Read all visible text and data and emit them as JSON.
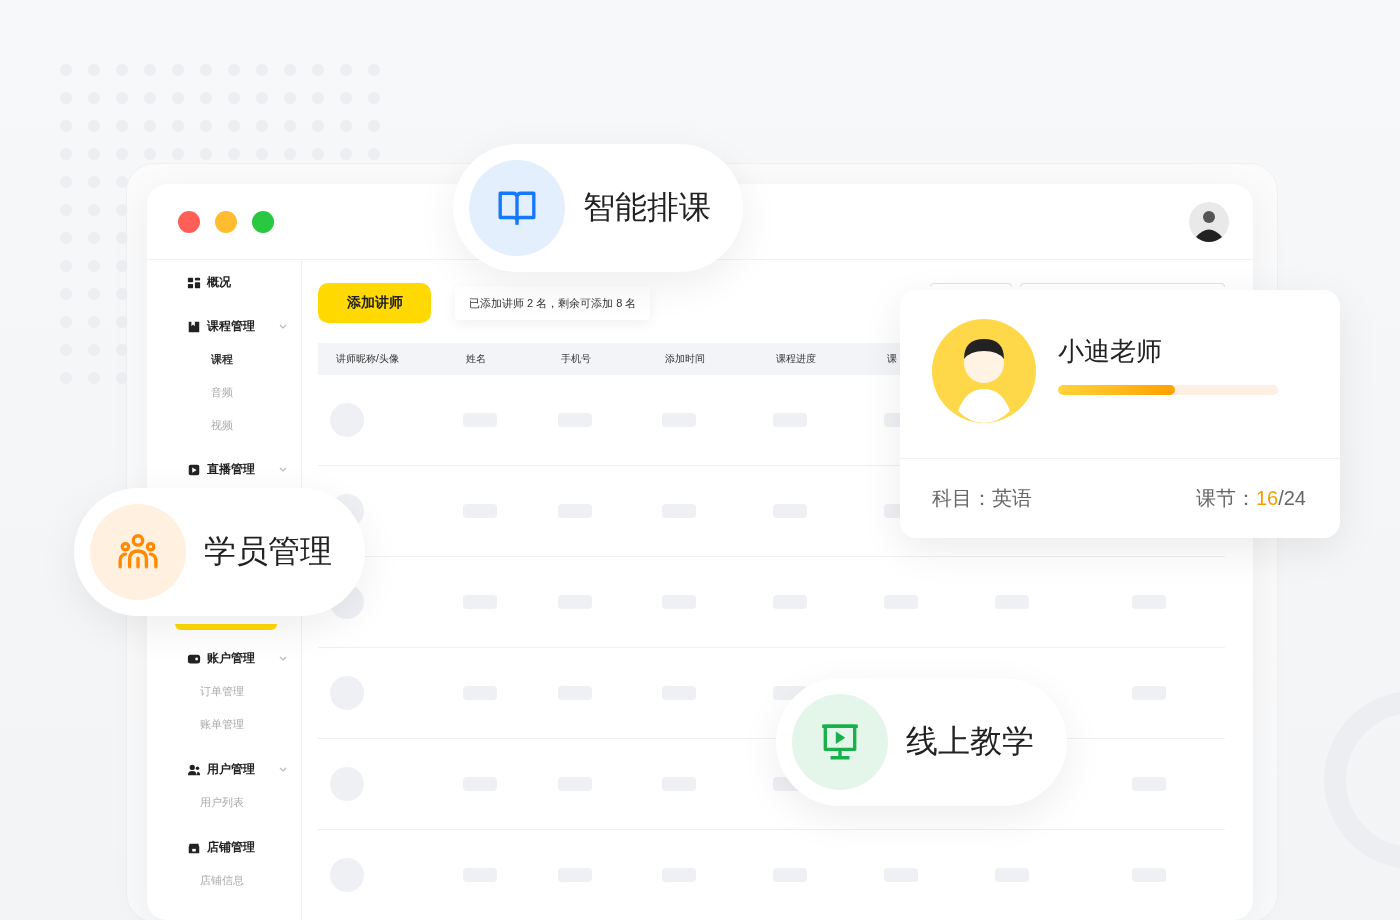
{
  "window": {
    "controls": [
      {
        "color": "#ff5f57"
      },
      {
        "color": "#febc2e"
      },
      {
        "color": "#28c840"
      }
    ]
  },
  "sidebar": {
    "sections": [
      {
        "items": [
          {
            "label": "概况",
            "kind": "grid",
            "expandable": false
          },
          {
            "label": "课程管理",
            "kind": "bookmark",
            "expandable": true,
            "children": [
              {
                "label": "课程",
                "selected": true
              },
              {
                "label": "音频",
                "selected": false
              },
              {
                "label": "视频",
                "selected": false
              }
            ]
          },
          {
            "label": "直播管理",
            "kind": "play",
            "expandable": true
          }
        ]
      },
      {
        "items": [
          {
            "label": "账户管理",
            "kind": "wallet",
            "expandable": true,
            "children": [
              {
                "label": "订单管理",
                "selected": false
              },
              {
                "label": "账单管理",
                "selected": false
              }
            ]
          },
          {
            "label": "用户管理",
            "kind": "users",
            "expandable": true,
            "children": [
              {
                "label": "用户列表",
                "selected": false
              }
            ]
          },
          {
            "label": "店铺管理",
            "kind": "store",
            "expandable": false,
            "children": [
              {
                "label": "店铺信息",
                "selected": false
              }
            ]
          }
        ]
      }
    ]
  },
  "toolbar": {
    "add_button": "添加讲师",
    "quota_note": "已添加讲师 2 名，剩余可添加 8 名"
  },
  "table": {
    "columns": [
      "讲师昵称/头像",
      "姓名",
      "手机号",
      "添加时间",
      "课程进度",
      "课"
    ]
  },
  "features": [
    {
      "label": "智能排课",
      "kind": "book",
      "color": "#1677ff"
    },
    {
      "label": "学员管理",
      "kind": "people",
      "color": "#ff8a00"
    },
    {
      "label": "线上教学",
      "kind": "screen",
      "color": "#17b04b"
    }
  ],
  "teacher_card": {
    "name": "小迪老师",
    "level": 0.53,
    "subject_label": "科目：",
    "subject": "英语",
    "lessons_label": "课节：",
    "lessons_done": "16",
    "lessons_total": "/24"
  }
}
